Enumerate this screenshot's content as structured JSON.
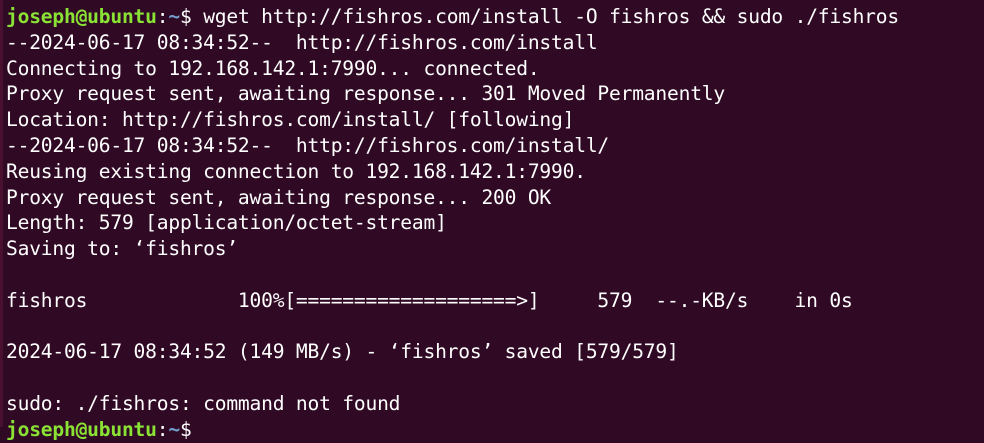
{
  "prompt": {
    "user_host": "joseph@ubuntu",
    "sep": ":",
    "path": "~",
    "symbol": "$ "
  },
  "command": "wget http://fishros.com/install -O fishros && sudo ./fishros",
  "output": [
    "--2024-06-17 08:34:52--  http://fishros.com/install",
    "Connecting to 192.168.142.1:7990... connected.",
    "Proxy request sent, awaiting response... 301 Moved Permanently",
    "Location: http://fishros.com/install/ [following]",
    "--2024-06-17 08:34:52--  http://fishros.com/install/",
    "Reusing existing connection to 192.168.142.1:7990.",
    "Proxy request sent, awaiting response... 200 OK",
    "Length: 579 [application/octet-stream]",
    "Saving to: ‘fishros’",
    "",
    "fishros             100%[===================>]     579  --.-KB/s    in 0s",
    "",
    "2024-06-17 08:34:52 (149 MB/s) - ‘fishros’ saved [579/579]",
    "",
    "sudo: ./fishros: command not found"
  ],
  "colors": {
    "background": "#300a24",
    "user": "#8ae234",
    "path": "#729fcf",
    "text": "#ffffff"
  }
}
